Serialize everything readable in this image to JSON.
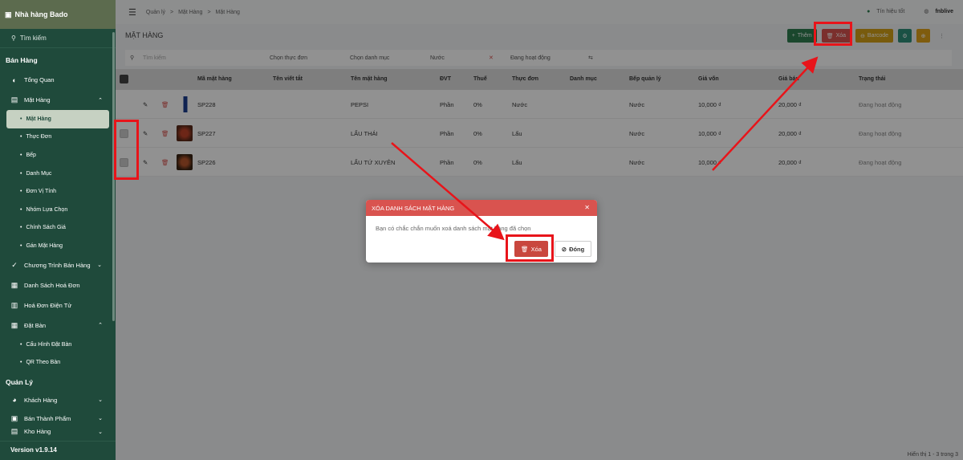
{
  "sidebar": {
    "restaurant": "Nhà hàng Bado",
    "search": "Tìm kiếm",
    "section_sales": "Bán Hàng",
    "items": [
      {
        "label": "Tổng Quan"
      },
      {
        "label": "Mặt Hàng"
      },
      {
        "label": "Mặt Hàng"
      },
      {
        "label": "Thực Đơn"
      },
      {
        "label": "Bếp"
      },
      {
        "label": "Danh Mục"
      },
      {
        "label": "Đơn Vị Tính"
      },
      {
        "label": "Nhóm Lựa Chọn"
      },
      {
        "label": "Chính Sách Giá"
      },
      {
        "label": "Gán Mặt Hàng"
      },
      {
        "label": "Chương Trình Bán Hàng"
      },
      {
        "label": "Danh Sách Hoá Đơn"
      },
      {
        "label": "Hoá Đơn Điện Tử"
      },
      {
        "label": "Đặt Bàn"
      },
      {
        "label": "Cấu Hình Đặt Bàn"
      },
      {
        "label": "QR Theo Bàn"
      }
    ],
    "section_manage": "Quản Lý",
    "manage_items": [
      {
        "label": "Khách Hàng"
      },
      {
        "label": "Bán Thành Phẩm"
      },
      {
        "label": "Kho Hàng"
      }
    ],
    "version": "Version v1.9.14"
  },
  "topbar": {
    "crumbs": [
      "Quản lý",
      ">",
      "Mặt Hàng",
      ">",
      "Mặt Hàng"
    ],
    "signal": "Tín hiệu tốt",
    "user": "fnblive"
  },
  "page": {
    "title": "MẶT HÀNG",
    "add": "Thêm",
    "delete": "Xóa",
    "barcode": "Barcode"
  },
  "filter": {
    "search": "Tìm kiếm",
    "menu": "Chọn thực đơn",
    "category": "Chọn danh mục",
    "drink": "Nước",
    "status": "Đang hoạt động"
  },
  "table": {
    "headers": [
      "Mã mặt hàng",
      "Tên viết tắt",
      "Tên mặt hàng",
      "ĐVT",
      "Thuế",
      "Thực đơn",
      "Danh mục",
      "Bếp quản lý",
      "Giá vốn",
      "Giá bán",
      "Trạng thái"
    ],
    "rows": [
      {
        "code": "SP228",
        "name": "PEPSI",
        "unit": "Phần",
        "tax": "0%",
        "menu": "Nước",
        "kitchen": "Nước",
        "cost": "10,000 ₫",
        "price": "20,000 ₫",
        "status": "Đang hoạt động"
      },
      {
        "code": "SP227",
        "name": "LẨU THÁI",
        "unit": "Phần",
        "tax": "0%",
        "menu": "Lẩu",
        "kitchen": "Nước",
        "cost": "10,000 ₫",
        "price": "20,000 ₫",
        "status": "Đang hoạt động"
      },
      {
        "code": "SP226",
        "name": "LẨU TỨ XUYÊN",
        "unit": "Phần",
        "tax": "0%",
        "menu": "Lẩu",
        "kitchen": "Nước",
        "cost": "10,000 ₫",
        "price": "20,000 ₫",
        "status": "Đang hoạt động"
      }
    ]
  },
  "footer": "Hiển thị 1 - 3 trong 3",
  "modal": {
    "title": "XÓA DANH SÁCH MẶT HÀNG",
    "message": "Bạn có chắc chắn muốn xoá danh sách mặt hàng đã chọn",
    "delete": "Xóa",
    "close": "Đóng"
  }
}
